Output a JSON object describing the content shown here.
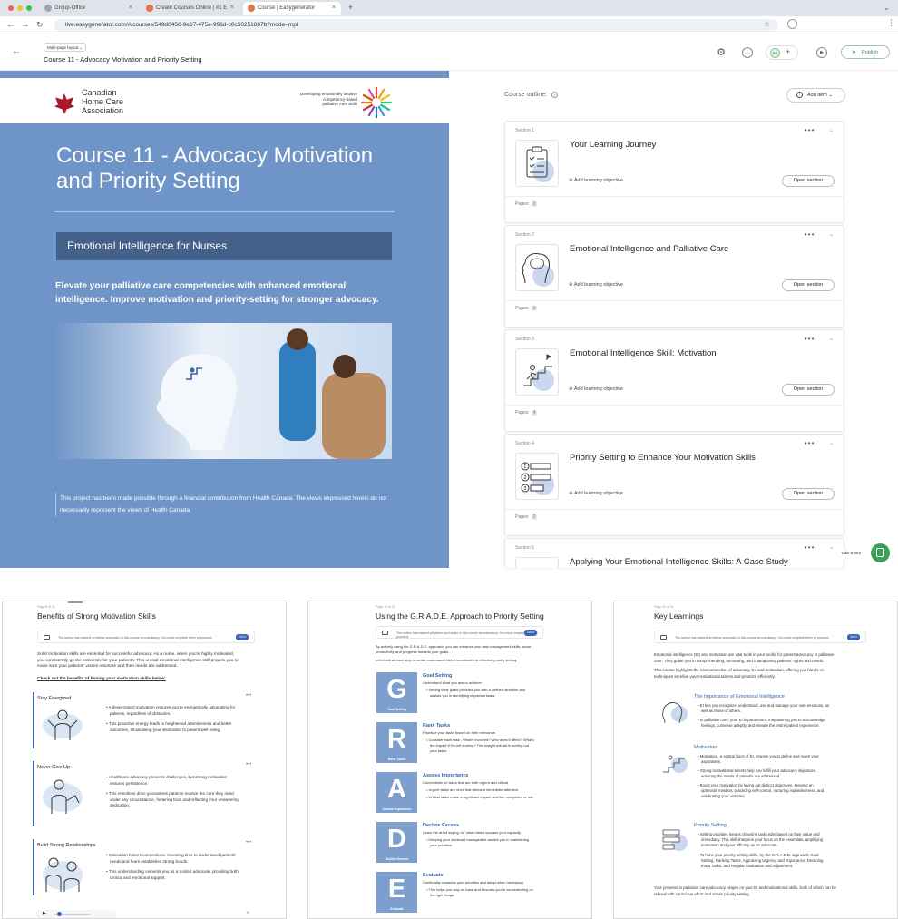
{
  "browser": {
    "tabs": [
      {
        "label": "Group-Office"
      },
      {
        "label": "Create Courses Online | #1 E"
      },
      {
        "label": "Course | Easygenerator"
      }
    ],
    "url": "live.easygenerator.com/#/courses/549d0456-9e87-475e-996d-c0c50251867b?mode=mpl"
  },
  "header": {
    "layout_label": "Multi-page layout",
    "course_title": "Course 11 - Advocacy Motivation and Priority Setting",
    "avatar_initials": "RH",
    "publish_label": "Publish"
  },
  "cover": {
    "org_name_line1": "Canadian",
    "org_name_line2": "Home Care",
    "org_name_line3": "Association",
    "partner_line1": "Developing emotionally intuitive",
    "partner_line2": "competency-based",
    "partner_line3": "palliative care skills",
    "title": "Course 11 - Advocacy Motivation and Priority Setting",
    "subtitle": "Emotional Intelligence for Nurses",
    "tagline": "Elevate your palliative care competencies with enhanced emotional intelligence. Improve motivation and priority-setting for stronger advocacy.",
    "disclaimer": "This project has been made possible through a financial contribution from Health Canada. The views expressed herein do not necessarily represent the views of Health Canada."
  },
  "outline": {
    "label": "Course outline:",
    "add_item_label": "Add item",
    "sections": [
      {
        "label": "Section 1",
        "name": "Your Learning Journey",
        "objective": "Add learning objective",
        "open_label": "Open section",
        "pages_label": "Pages:",
        "pages": "3"
      },
      {
        "label": "Section 2",
        "name": "Emotional Intelligence and Palliative Care",
        "objective": "Add learning objective",
        "open_label": "Open section",
        "pages_label": "Pages:",
        "pages": "3"
      },
      {
        "label": "Section 3",
        "name": "Emotional Intelligence Skill: Motivation",
        "objective": "Add learning objective",
        "open_label": "Open section",
        "pages_label": "Pages:",
        "pages": "4"
      },
      {
        "label": "Section 4",
        "name": "Priority Setting to Enhance Your Motivation Skills",
        "objective": "Add learning objective",
        "open_label": "Open section",
        "pages_label": "Pages:",
        "pages": "3"
      },
      {
        "label": "Section 5",
        "name": "Applying Your Emotional Intelligence Skills: A Case Study"
      }
    ],
    "take_tour_label": "Take a tour"
  },
  "page_a": {
    "page_num": "Page 8 of 31",
    "title": "Benefits of Strong Motivation Skills",
    "video_note": "The author has marked all videos and audio in this course as mandatory. You must complete them to proceed.",
    "got_it": "Got it",
    "intro1": "Solid motivation skills are essential for successful advocacy. As a nurse, when you're highly motivated,",
    "intro2": "you consistently go the extra mile for your patients. This crucial emotional intelligence skill propels you to",
    "intro3": "make sure your patients' voices resonate and their needs are addressed.",
    "check": "Check out the benefits of honing your motivation skills below:",
    "b1_title": "Stay Energized",
    "b1_1a": "A deep-rooted motivation ensures you're energetically advocating for",
    "b1_1b": "patients, regardless of obstacles.",
    "b1_2a": "This proactive energy leads to heightened attentiveness and better",
    "b1_2b": "outcomes, showcasing your dedication to patient well-being.",
    "b2_title": "Never Give Up",
    "b2_1a": "Healthcare advocacy presents challenges, but strong motivation",
    "b2_1b": "ensures persistence.",
    "b2_2a": "This relentless drive guarantees patients receive the care they need",
    "b2_2b": "under any circumstance, fostering trust and reflecting your unwavering",
    "b2_2c": "dedication.",
    "b3_title": "Build Strong Relationships",
    "b3_1a": "Motivation fosters connections. Investing time to understand patients'",
    "b3_1b": "needs and fears establishes strong bonds.",
    "b3_2a": "This understanding cements you as a trusted advocate, providing both",
    "b3_2b": "clinical and emotional support."
  },
  "page_b": {
    "page_num": "Page 10 of 31",
    "title": "Using the G.R.A.D.E. Approach to Priority Setting",
    "video_note": "The author has marked all videos and audio in this course as mandatory. You must complete them to proceed.",
    "got_it": "Got it",
    "intro1": "By actively using the G.R.A.D.E. approach, you can enhance your task management skills, boost",
    "intro2": "productivity, and progress towards your goals.",
    "intro3": "Let's look at each step to better understand how it contributes to effective priority setting.",
    "steps": [
      {
        "letter": "G",
        "caption": "Goal Setting",
        "title": "Goal Setting",
        "desc": "Understand what you aim to achieve.",
        "b1": "Setting clear goals provides you with a defined direction and",
        "b2": "assists you in identifying important tasks."
      },
      {
        "letter": "R",
        "caption": "Rank Tasks",
        "title": "Rank Tasks",
        "desc": "Prioritize your tasks based on their relevance.",
        "b1": "Consider each task - What's involved? Who does it affect? What's",
        "b2": "the impact if it's left undone? This insight will aid in sorting out your tasks."
      },
      {
        "letter": "A",
        "caption": "Assess Importance",
        "title": "Assess Importance",
        "desc": "Concentrate on tasks that are both urgent and critical.",
        "b1": "Urgent tasks are ones that demand immediate attention.",
        "b2": "Critical tasks make a significant impact whether completed or not."
      },
      {
        "letter": "D",
        "caption": "Decline Excess",
        "title": "Decline Excess",
        "desc": "Learn the art of saying 'no' when tasks surpass your capacity.",
        "b1": "Keeping your workload manageable assists you in maintaining",
        "b2": "your priorities."
      },
      {
        "letter": "E",
        "caption": "Evaluate",
        "title": "Evaluate",
        "desc": "Continually reassess your priorities and adapt when necessary.",
        "b1": "This helps you stay on track and ensures you're concentrating on",
        "b2": "the right things."
      }
    ]
  },
  "page_c": {
    "page_num": "Page 22 of 31",
    "title": "Key Learnings",
    "video_note": "The author has marked all videos and audio in this course as mandatory. You must complete them to proceed.",
    "got_it": "Got it",
    "intro1": "Emotional intelligence (EI) and motivation are vital tools in your toolkit for patient advocacy in palliative",
    "intro2": "care. They guide you in comprehending, honouring, and championing patients' rights and needs.",
    "intro3": "This course highlights the interconnection of advocacy, EI, and motivation, offering you hands-on",
    "intro4": "techniques to refine your motivational talents and prioritize efficiently.",
    "k1_title": "The Importance of Emotional Intelligence",
    "k1_1a": "EI lets you recognize, understand, use and manage your own emotions, as",
    "k1_1b": "well as those of others.",
    "k1_2a": "In palliative care, your EI is paramount, empowering you to acknowledge",
    "k1_2b": "feelings, converse adeptly, and elevate the entire patient experience.",
    "k2_title": "Motivation",
    "k2_1a": "Motivation, a central facet of EI, propels you to define and reach your",
    "k2_1b": "aspirations.",
    "k2_2a": "Strong motivational talents help you fulfill your advocacy objectives,",
    "k2_2b": "ensuring the needs of patients are addressed.",
    "k2_3a": "Boost your motivation by laying out distinct objectives, keeping an",
    "k2_3b": "optimistic mindset, practicing self-control, nurturing inquisitiveness, and",
    "k2_3c": "celebrating your victories.",
    "k3_title": "Priority Setting",
    "k3_1a": "Setting priorities means choosing task order based on their value and",
    "k3_1b": "immediacy. This skill sharpens your focus on the essentials, amplifying",
    "k3_1c": "motivation and your efficacy as an advocate.",
    "k3_2a": "To hone your priority-setting skills, try the G.R.A.D.E. approach: Goal",
    "k3_2b": "Setting, Ranking Tasks, Appraising Urgency and Importance, Declining",
    "k3_2c": "Extra Tasks, and Regular Evaluation and Adjustment.",
    "outro1": "Your prowess in palliative care advocacy hinges on your EI and motivational skills, both of which can be",
    "outro2": "refined with conscious effort and astute priority setting."
  },
  "colors": {
    "cover_blue": "#6f95c8",
    "subtitle_bar": "#43618a",
    "accent_blue": "#3a62a8",
    "grade_tile": "#7c9fce",
    "publish_green": "#3b8a55"
  }
}
